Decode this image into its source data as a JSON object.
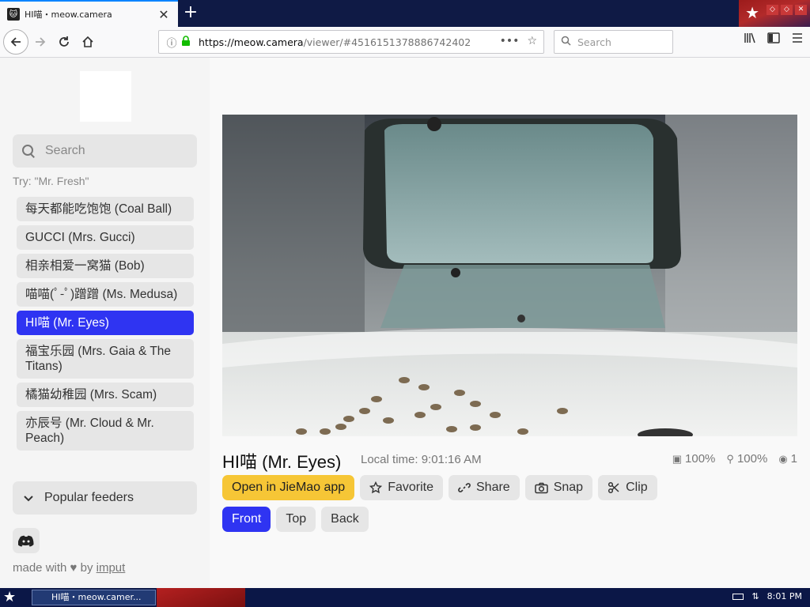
{
  "browser": {
    "tab_title": "HI喵・meow.camera",
    "url_host": "https://meow.camera",
    "url_rest": "/viewer/#4516151378886742402",
    "search_placeholder": "Search"
  },
  "sidebar": {
    "search_placeholder": "Search",
    "try_text": "Try: \"Mr. Fresh\"",
    "cats": [
      {
        "label": "每天都能吃饱饱 (Coal Ball)",
        "active": false
      },
      {
        "label": "GUCCI (Mrs. Gucci)",
        "active": false
      },
      {
        "label": "相亲相爱一窝猫 (Bob)",
        "active": false
      },
      {
        "label": "喵喵(ﾟ-ﾟ)蹭蹭 (Ms. Medusa)",
        "active": false
      },
      {
        "label": "HI喵 (Mr. Eyes)",
        "active": true
      },
      {
        "label": "福宝乐园 (Mrs. Gaia & The Titans)",
        "active": false
      },
      {
        "label": "橘猫幼稚园 (Mrs. Scam)",
        "active": false
      },
      {
        "label": "亦辰号 (Mr. Cloud & Mr. Peach)",
        "active": false
      }
    ],
    "popular_label": "Popular feeders",
    "made_prefix": "made with",
    "made_by": "by",
    "made_link": "imput"
  },
  "camera": {
    "title": "HI喵 (Mr. Eyes)",
    "local_time": "Local time: 9:01:16 AM",
    "food_level": "100%",
    "battery_level": "100%",
    "viewers": "1",
    "buttons": {
      "open_app": "Open in JieMao app",
      "favorite": "Favorite",
      "share": "Share",
      "snap": "Snap",
      "clip": "Clip"
    },
    "views": {
      "front": "Front",
      "top": "Top",
      "back": "Back"
    }
  },
  "taskbar": {
    "task_label": "HI喵・meow.camer...",
    "clock": "8:01 PM"
  }
}
